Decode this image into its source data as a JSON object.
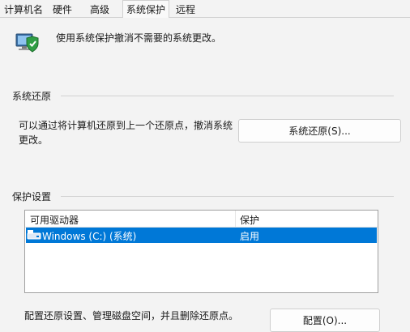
{
  "tabs": [
    {
      "label": "计算机名",
      "active": false
    },
    {
      "label": "硬件",
      "active": false
    },
    {
      "label": "高级",
      "active": false
    },
    {
      "label": "系统保护",
      "active": true
    },
    {
      "label": "远程",
      "active": false
    }
  ],
  "header": {
    "description": "使用系统保护撤消不需要的系统更改。",
    "icon": "system-protection-shield-icon"
  },
  "restore": {
    "section_label": "系统还原",
    "text": "可以通过将计算机还原到上一个还原点，撤消系统更改。",
    "button_label": "系统还原(S)..."
  },
  "protection": {
    "section_label": "保护设置",
    "columns": [
      "可用驱动器",
      "保护"
    ],
    "rows": [
      {
        "drive": "Windows (C:) (系统)",
        "protection": "启用",
        "selected": true,
        "icon": "drive-icon"
      }
    ]
  },
  "config": {
    "text": "配置还原设置、管理磁盘空间，并且删除还原点。",
    "button_label": "配置(O)..."
  },
  "colors": {
    "selection": "#0078d7",
    "background": "#f3f3f3"
  }
}
